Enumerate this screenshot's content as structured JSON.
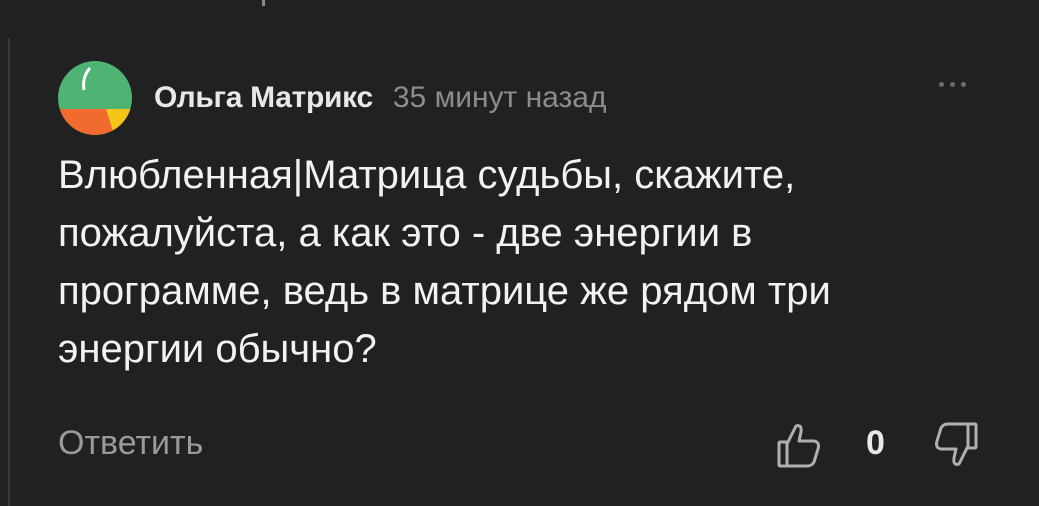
{
  "comment": {
    "author": "Ольга Матрикс",
    "time": "35 минут назад",
    "text": "Влюбленная|Матрица судьбы, скажите, пожалуйста, а как это - две энергии в программе, ведь в матрице же рядом три энергии обычно?",
    "reply_label": "Ответить",
    "like_count": "0",
    "avatar_colors": {
      "green": "#4fb374",
      "orange": "#f26b2e",
      "yellow": "#f5c518"
    },
    "icons": {
      "like": "thumbs-up-icon",
      "dislike": "thumbs-down-icon",
      "more": "more-dots-icon"
    }
  }
}
